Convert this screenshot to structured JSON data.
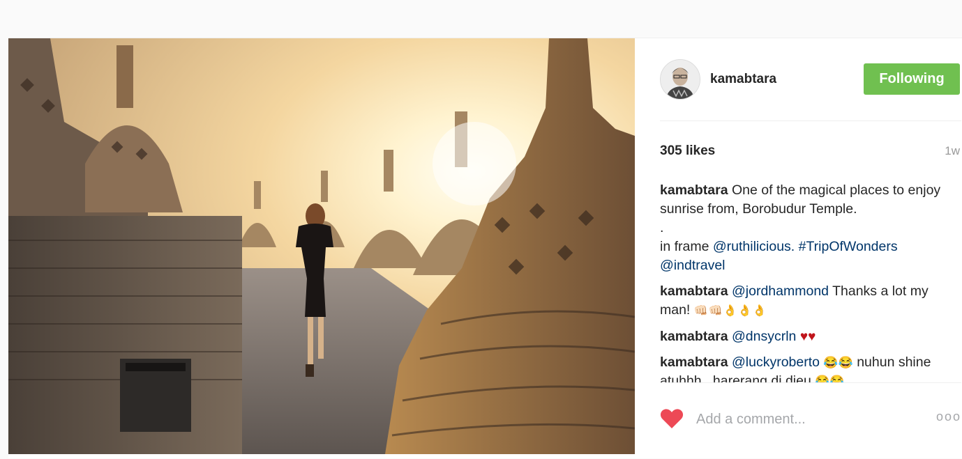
{
  "header": {
    "username": "kamabtara",
    "follow_label": "Following"
  },
  "stats": {
    "likes": "305 likes",
    "age": "1w"
  },
  "comments": [
    {
      "user": "kamabtara",
      "line1": "One of the magical places to enjoy sunrise from, Borobudur Temple.",
      "dot": ".",
      "in_frame": "in frame",
      "mention1": "@ruthilicious.",
      "hashtag": "#TripOfWonders",
      "mention2": "@indtravel"
    },
    {
      "user": "kamabtara",
      "mention": "@jordhammond",
      "text": "Thanks a lot my man!",
      "emoji": "👊🏻👊🏻👌👌👌"
    },
    {
      "user": "kamabtara",
      "mention": "@dnsycrln",
      "emoji": "♥♥"
    },
    {
      "user": "kamabtara",
      "mention": "@luckyroberto",
      "emoji1": "😂😂",
      "text": "nuhun shine atuhhh.. harerang di dieu",
      "emoji2": "😂😂"
    }
  ],
  "footer": {
    "comment_placeholder": "Add a comment...",
    "more_label": "ooo"
  },
  "colors": {
    "follow_green": "#70c050",
    "heart_red": "#ed4956",
    "mention_blue": "#003569"
  },
  "icons": {
    "like": "heart-icon",
    "more": "more-options-icon"
  }
}
